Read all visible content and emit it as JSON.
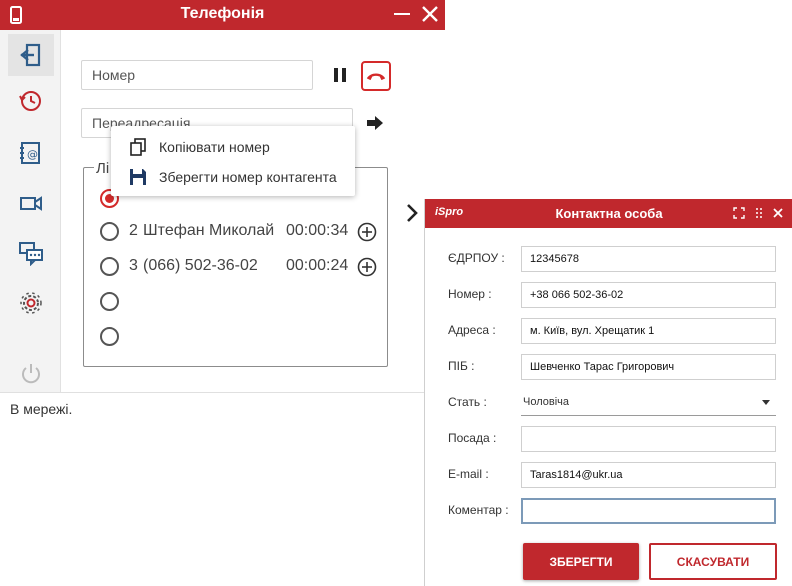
{
  "telephony": {
    "title": "Телефонія",
    "number_placeholder": "Номер",
    "redirect_placeholder": "Переадресація",
    "lines_label": "Лі",
    "lines": [
      {
        "index": "",
        "name": "",
        "time": "",
        "active": true
      },
      {
        "index": "2",
        "name": "Штефан Миколай",
        "time": "00:00:34",
        "active": false
      },
      {
        "index": "3",
        "name": "(066) 502-36-02",
        "time": "00:00:24",
        "active": false
      },
      {
        "index": "",
        "name": "",
        "time": "",
        "active": false
      },
      {
        "index": "",
        "name": "",
        "time": "",
        "active": false
      }
    ],
    "status": "В мережі."
  },
  "context_menu": {
    "items": [
      {
        "label": "Копіювати номер",
        "icon": "copy-icon"
      },
      {
        "label": "Зберегти номер контагента",
        "icon": "floppy-disk-icon"
      }
    ]
  },
  "contact": {
    "logo": "iSpro",
    "title": "Контактна особа",
    "fields": {
      "edrpou": {
        "label": "ЄДРПОУ :",
        "value": "12345678"
      },
      "phone": {
        "label": "Номер :",
        "value": "+38 066 502-36-02"
      },
      "address": {
        "label": "Адреса :",
        "value": "м. Київ, вул. Хрещатик 1"
      },
      "pib": {
        "label": "ПІБ :",
        "value": "Шевченко Тарас Григорович"
      },
      "gender": {
        "label": "Стать :",
        "value": "Чоловіча"
      },
      "position": {
        "label": "Посада :",
        "value": ""
      },
      "email": {
        "label": "E-mail :",
        "value": "Taras1814@ukr.ua"
      },
      "comment": {
        "label": "Коментар :",
        "value": ""
      }
    },
    "save_label": "ЗБЕРЕГТИ",
    "cancel_label": "СКАСУВАТИ"
  },
  "colors": {
    "brand_red": "#c0282d",
    "hangup_red": "#d42a2a",
    "icon_blue": "#2f5d8a"
  }
}
